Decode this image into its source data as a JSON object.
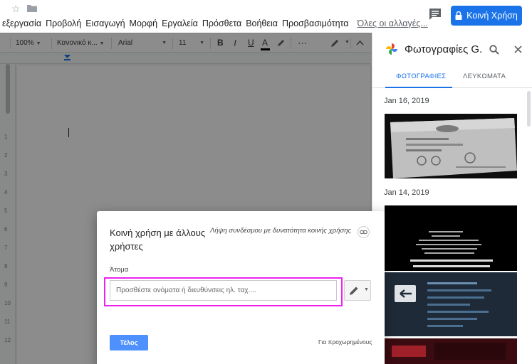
{
  "menu": {
    "items": [
      "εξεργασία",
      "Προβολή",
      "Εισαγωγή",
      "Μορφή",
      "Εργαλεία",
      "Πρόσθετα",
      "Βοήθεια",
      "Προσβασιμότητα"
    ],
    "last_edit": "Όλες οι αλλαγές..."
  },
  "share_button": {
    "label": "Κοινή Χρήση"
  },
  "toolbar": {
    "zoom": "100%",
    "style": "Κανονικό κ...",
    "font": "Arial",
    "size": "11",
    "bold": "B",
    "italic": "I",
    "underline": "U",
    "text_color": "A",
    "more": "⋯"
  },
  "ruler_numbers": [
    "1",
    "2",
    "3",
    "4",
    "5",
    "6",
    "7",
    "8",
    "9",
    "10",
    "11",
    "12"
  ],
  "sidepanel": {
    "title": "Φωτογραφίες G...",
    "tabs": [
      "ΦΩΤΟΓΡΑΦΙΕΣ",
      "ΛΕΥΚΩΜΑΤΑ"
    ],
    "active_tab": "ΦΩΤΟΓΡΑΦΙΕΣ",
    "dates": [
      "Jan 16, 2019",
      "Jan 14, 2019"
    ]
  },
  "dialog": {
    "title": "Κοινή χρήση με άλλους χρήστες",
    "get_link": "Λήψη συνδέσμου με δυνατότητα κοινής χρήσης",
    "people_label": "Άτομα",
    "input_placeholder": "Προσθέστε ονόματα ή διευθύνσεις ηλ. ταχ....",
    "done_label": "Τέλος",
    "advanced_label": "Για προχωρημένους"
  },
  "colors": {
    "accent": "#1a73e8",
    "done_button": "#4d90fe",
    "highlight": "#ee22ee"
  }
}
